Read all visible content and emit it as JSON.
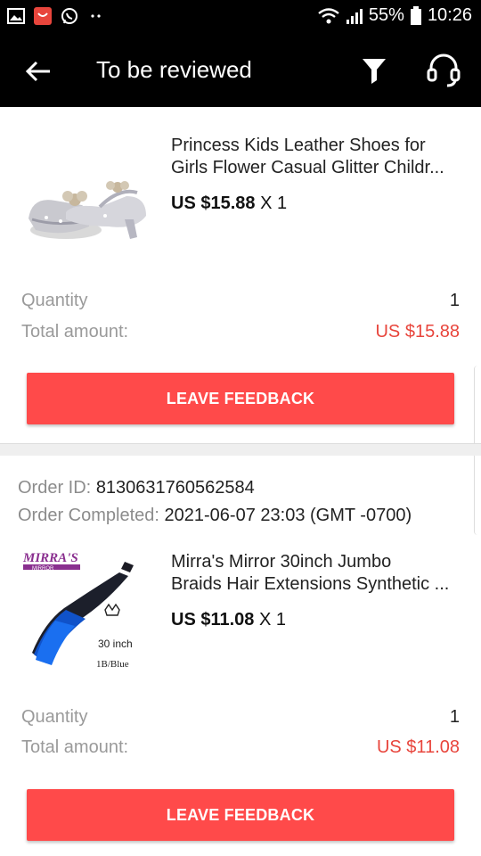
{
  "status_bar": {
    "battery": "55%",
    "time": "10:26",
    "left_icons": [
      "gallery-icon",
      "aliexpress-icon",
      "whatsapp-icon",
      "more-dots-icon"
    ],
    "right_icons": [
      "wifi-icon",
      "signal-icon",
      "battery-icon"
    ]
  },
  "app_bar": {
    "title": "To be reviewed",
    "icons": [
      "back-arrow-icon",
      "filter-icon",
      "support-headset-icon"
    ]
  },
  "orders": [
    {
      "product_title_line1": "Princess Kids Leather Shoes for",
      "product_title_line2": "Girls Flower Casual Glitter Childr...",
      "price": "US $15.88",
      "qty_multiplier": "X 1",
      "quantity_label": "Quantity",
      "quantity_value": "1",
      "total_label": "Total amount:",
      "total_value": "US $15.88",
      "button_label": "LEAVE FEEDBACK"
    },
    {
      "order_id_label": "Order ID:",
      "order_id": "8130631760562584",
      "completed_label": "Order Completed:",
      "completed_value": "2021-06-07 23:03 (GMT -0700)",
      "product_title_line1": "Mirra's Mirror 30inch Jumbo",
      "product_title_line2": "Braids Hair Extensions Synthetic ...",
      "price": "US $11.08",
      "qty_multiplier": "X 1",
      "quantity_label": "Quantity",
      "quantity_value": "1",
      "total_label": "Total amount:",
      "total_value": "US $11.08",
      "button_label": "LEAVE FEEDBACK",
      "image_brand": "MIRRA'S",
      "image_brand_sub": "MIRROR",
      "image_text_1": "30 inch",
      "image_text_2": "1B/Blue"
    }
  ],
  "colors": {
    "accent_red": "#ff4a4a",
    "price_red": "#e8453c",
    "bar_black": "#000000"
  }
}
